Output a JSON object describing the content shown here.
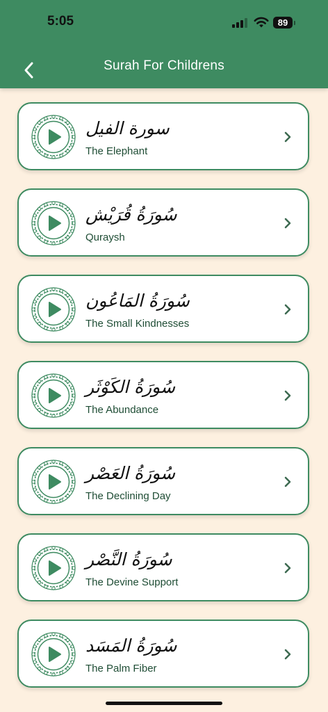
{
  "status_bar": {
    "time": "5:05",
    "battery": "89"
  },
  "header": {
    "title": "Surah For Childrens"
  },
  "colors": {
    "primary": "#3e8b61",
    "background": "#fdf0e0",
    "card": "#ffffff"
  },
  "surahs": [
    {
      "arabic": "سورة الفيل",
      "english": "The Elephant"
    },
    {
      "arabic": "سُورَةُ قُرَيْش",
      "english": "Quraysh"
    },
    {
      "arabic": "سُورَةُ المَاعُون",
      "english": "The Small Kindnesses"
    },
    {
      "arabic": "سُورَةُ الكَوْثَر",
      "english": "The Abundance"
    },
    {
      "arabic": "سُورَةُ العَصْر",
      "english": "The Declining Day"
    },
    {
      "arabic": "سُورَةُ النَّصْر",
      "english": "The Devine Support"
    },
    {
      "arabic": "سُورَةُ المَسَد",
      "english": "The Palm Fiber"
    }
  ]
}
